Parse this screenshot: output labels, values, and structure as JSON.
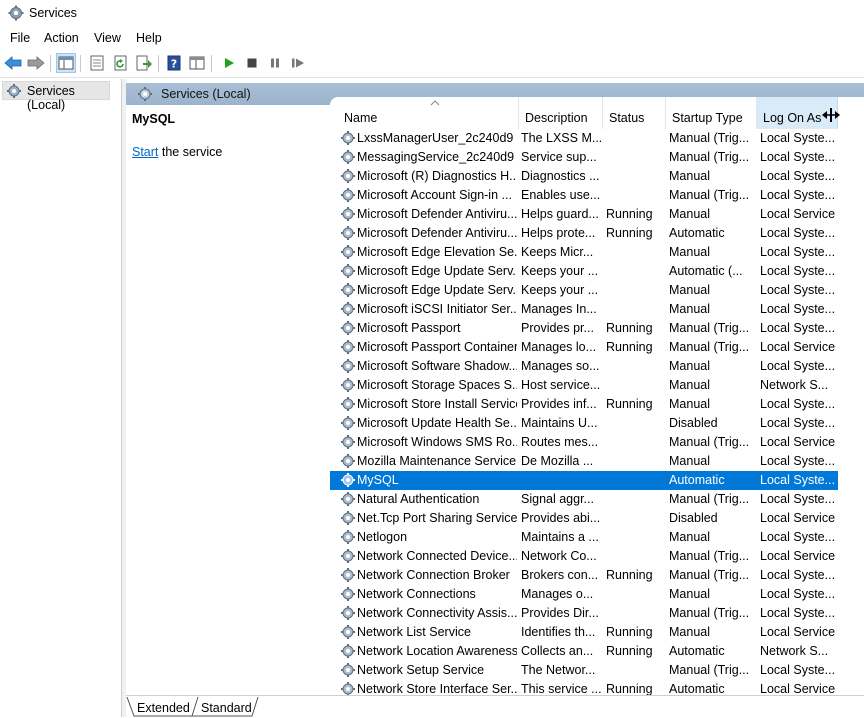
{
  "window": {
    "title": "Services"
  },
  "menu": [
    "File",
    "Action",
    "View",
    "Help"
  ],
  "toolbar": {
    "buttons": [
      "back-icon",
      "forward-icon",
      "show-hide-tree-icon",
      "properties-icon",
      "refresh-icon",
      "export-list-icon",
      "help-icon",
      "console-icon",
      "start-service-icon",
      "stop-service-icon",
      "pause-service-icon",
      "restart-service-icon"
    ]
  },
  "tree": {
    "root_label": "Services (Local)"
  },
  "panel": {
    "header": "Services (Local)"
  },
  "selected_service": {
    "name": "MySQL",
    "action_link": "Start",
    "action_rest": " the service"
  },
  "columns": [
    "Name",
    "Description",
    "Status",
    "Startup Type",
    "Log On As"
  ],
  "services": [
    {
      "name": "LxssManagerUser_2c240d9",
      "desc": "The LXSS M...",
      "status": "",
      "startup": "Manual (Trig...",
      "logon": "Local Syste..."
    },
    {
      "name": "MessagingService_2c240d9",
      "desc": "Service sup...",
      "status": "",
      "startup": "Manual (Trig...",
      "logon": "Local Syste..."
    },
    {
      "name": "Microsoft (R) Diagnostics H...",
      "desc": "Diagnostics ...",
      "status": "",
      "startup": "Manual",
      "logon": "Local Syste..."
    },
    {
      "name": "Microsoft Account Sign-in ...",
      "desc": "Enables use...",
      "status": "",
      "startup": "Manual (Trig...",
      "logon": "Local Syste..."
    },
    {
      "name": "Microsoft Defender Antiviru...",
      "desc": "Helps guard...",
      "status": "Running",
      "startup": "Manual",
      "logon": "Local Service"
    },
    {
      "name": "Microsoft Defender Antiviru...",
      "desc": "Helps prote...",
      "status": "Running",
      "startup": "Automatic",
      "logon": "Local Syste..."
    },
    {
      "name": "Microsoft Edge Elevation Se...",
      "desc": "Keeps Micr...",
      "status": "",
      "startup": "Manual",
      "logon": "Local Syste..."
    },
    {
      "name": "Microsoft Edge Update Serv...",
      "desc": "Keeps your ...",
      "status": "",
      "startup": "Automatic (...",
      "logon": "Local Syste..."
    },
    {
      "name": "Microsoft Edge Update Serv...",
      "desc": "Keeps your ...",
      "status": "",
      "startup": "Manual",
      "logon": "Local Syste..."
    },
    {
      "name": "Microsoft iSCSI Initiator Ser...",
      "desc": "Manages In...",
      "status": "",
      "startup": "Manual",
      "logon": "Local Syste..."
    },
    {
      "name": "Microsoft Passport",
      "desc": "Provides pr...",
      "status": "Running",
      "startup": "Manual (Trig...",
      "logon": "Local Syste..."
    },
    {
      "name": "Microsoft Passport Container",
      "desc": "Manages lo...",
      "status": "Running",
      "startup": "Manual (Trig...",
      "logon": "Local Service"
    },
    {
      "name": "Microsoft Software Shadow...",
      "desc": "Manages so...",
      "status": "",
      "startup": "Manual",
      "logon": "Local Syste..."
    },
    {
      "name": "Microsoft Storage Spaces S...",
      "desc": "Host service...",
      "status": "",
      "startup": "Manual",
      "logon": "Network S..."
    },
    {
      "name": "Microsoft Store Install Service",
      "desc": "Provides inf...",
      "status": "Running",
      "startup": "Manual",
      "logon": "Local Syste..."
    },
    {
      "name": "Microsoft Update Health Se...",
      "desc": "Maintains U...",
      "status": "",
      "startup": "Disabled",
      "logon": "Local Syste..."
    },
    {
      "name": "Microsoft Windows SMS Ro...",
      "desc": "Routes mes...",
      "status": "",
      "startup": "Manual (Trig...",
      "logon": "Local Service"
    },
    {
      "name": "Mozilla Maintenance Service",
      "desc": "De Mozilla ...",
      "status": "",
      "startup": "Manual",
      "logon": "Local Syste..."
    },
    {
      "name": "MySQL",
      "desc": "",
      "status": "",
      "startup": "Automatic",
      "logon": "Local Syste...",
      "selected": true
    },
    {
      "name": "Natural Authentication",
      "desc": "Signal aggr...",
      "status": "",
      "startup": "Manual (Trig...",
      "logon": "Local Syste..."
    },
    {
      "name": "Net.Tcp Port Sharing Service",
      "desc": "Provides abi...",
      "status": "",
      "startup": "Disabled",
      "logon": "Local Service"
    },
    {
      "name": "Netlogon",
      "desc": "Maintains a ...",
      "status": "",
      "startup": "Manual",
      "logon": "Local Syste..."
    },
    {
      "name": "Network Connected Device...",
      "desc": "Network Co...",
      "status": "",
      "startup": "Manual (Trig...",
      "logon": "Local Service"
    },
    {
      "name": "Network Connection Broker",
      "desc": "Brokers con...",
      "status": "Running",
      "startup": "Manual (Trig...",
      "logon": "Local Syste..."
    },
    {
      "name": "Network Connections",
      "desc": "Manages o...",
      "status": "",
      "startup": "Manual",
      "logon": "Local Syste..."
    },
    {
      "name": "Network Connectivity Assis...",
      "desc": "Provides Dir...",
      "status": "",
      "startup": "Manual (Trig...",
      "logon": "Local Syste..."
    },
    {
      "name": "Network List Service",
      "desc": "Identifies th...",
      "status": "Running",
      "startup": "Manual",
      "logon": "Local Service"
    },
    {
      "name": "Network Location Awareness",
      "desc": "Collects an...",
      "status": "Running",
      "startup": "Automatic",
      "logon": "Network S..."
    },
    {
      "name": "Network Setup Service",
      "desc": "The Networ...",
      "status": "",
      "startup": "Manual (Trig...",
      "logon": "Local Syste..."
    },
    {
      "name": "Network Store Interface Ser...",
      "desc": "This service ...",
      "status": "Running",
      "startup": "Automatic",
      "logon": "Local Service"
    }
  ],
  "tabs": [
    "Extended",
    "Standard"
  ],
  "colors": {
    "selection": "#0078d7",
    "header_band": "#a9bfd6",
    "link": "#0066cc"
  }
}
